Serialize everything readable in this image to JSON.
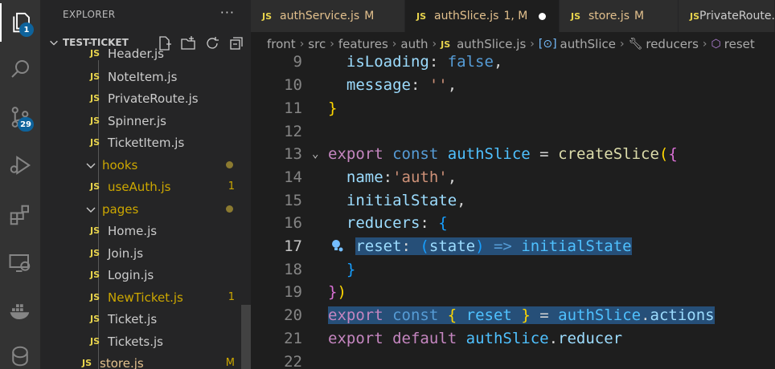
{
  "activity_bar": {
    "items": [
      {
        "icon": "explorer-icon",
        "badge": "1"
      },
      {
        "icon": "search-icon",
        "badge": ""
      },
      {
        "icon": "source-control-icon",
        "badge": "29"
      },
      {
        "icon": "run-debug-icon",
        "badge": ""
      },
      {
        "icon": "extensions-icon",
        "badge": ""
      },
      {
        "icon": "remote-explorer-icon",
        "badge": ""
      },
      {
        "icon": "docker-icon",
        "badge": ""
      },
      {
        "icon": "database-icon",
        "badge": ""
      }
    ]
  },
  "sidebar": {
    "title": "EXPLORER",
    "more": "···",
    "section": "TEST-TICKET",
    "file_icon": "JS",
    "rows": [
      {
        "label": "Header.js",
        "kind": "file",
        "state": "normal",
        "status": ""
      },
      {
        "label": "NoteItem.js",
        "kind": "file",
        "state": "normal",
        "status": ""
      },
      {
        "label": "PrivateRoute.js",
        "kind": "file",
        "state": "normal",
        "status": ""
      },
      {
        "label": "Spinner.js",
        "kind": "file",
        "state": "normal",
        "status": ""
      },
      {
        "label": "TicketItem.js",
        "kind": "file",
        "state": "normal",
        "status": ""
      },
      {
        "label": "hooks",
        "kind": "folder",
        "state": "mod",
        "status": "dot"
      },
      {
        "label": "useAuth.js",
        "kind": "file",
        "state": "mod",
        "status": "1"
      },
      {
        "label": "pages",
        "kind": "folder",
        "state": "mod",
        "status": "dot"
      },
      {
        "label": "Home.js",
        "kind": "file",
        "state": "normal",
        "status": ""
      },
      {
        "label": "Join.js",
        "kind": "file",
        "state": "normal",
        "status": ""
      },
      {
        "label": "Login.js",
        "kind": "file",
        "state": "normal",
        "status": ""
      },
      {
        "label": "NewTicket.js",
        "kind": "file",
        "state": "mod",
        "status": "1"
      },
      {
        "label": "Ticket.js",
        "kind": "file",
        "state": "normal",
        "status": ""
      },
      {
        "label": "Tickets.js",
        "kind": "file",
        "state": "normal",
        "status": ""
      },
      {
        "label": "store.js",
        "kind": "file",
        "state": "git",
        "status": "M"
      }
    ]
  },
  "tabs": [
    {
      "label": "authService.js",
      "status": "M",
      "active": false,
      "dirty": false
    },
    {
      "label": "authSlice.js",
      "status": "1, M",
      "active": true,
      "dirty": true
    },
    {
      "label": "store.js",
      "status": "M",
      "active": false,
      "dirty": false
    },
    {
      "label": "PrivateRoute.js",
      "status": "",
      "active": false,
      "dirty": false
    }
  ],
  "breadcrumb": [
    "front",
    "src",
    "features",
    "auth",
    "authSlice.js",
    "authSlice",
    "reducers",
    "reset"
  ],
  "editor": {
    "line_numbers": [
      "9",
      "10",
      "11",
      "12",
      "13",
      "14",
      "15",
      "16",
      "17",
      "18",
      "19",
      "20",
      "21",
      "22"
    ],
    "current_line": "17"
  },
  "colors": {
    "accent": "#0e639c",
    "modified": "#e2c08d",
    "selection": "#264f78"
  }
}
